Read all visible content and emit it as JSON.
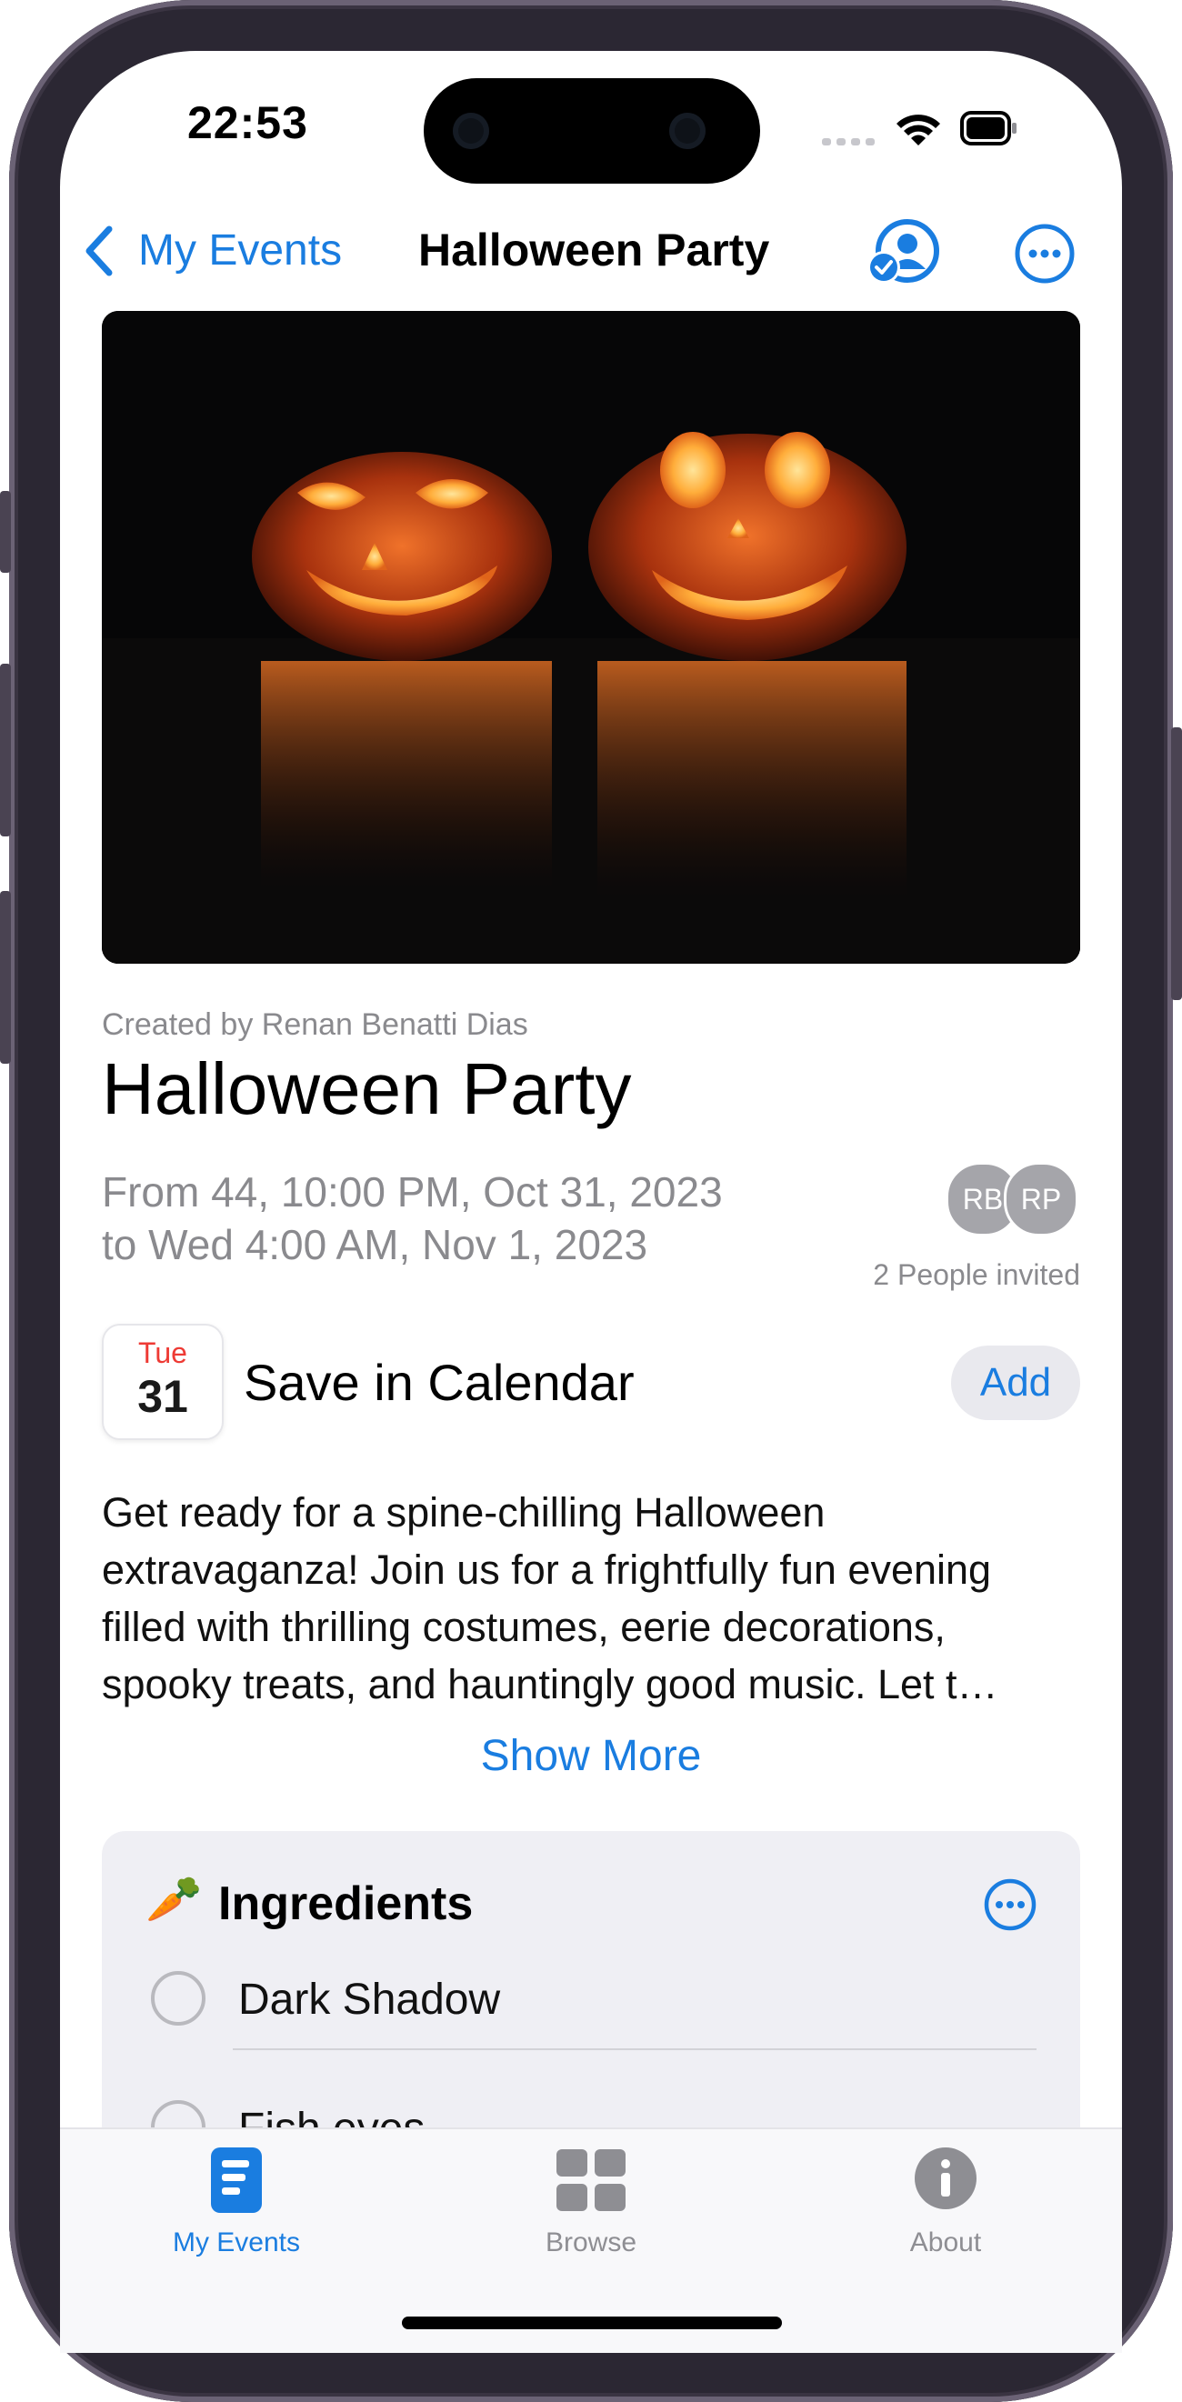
{
  "status_bar": {
    "time": "22:53"
  },
  "nav": {
    "back_label": "My Events",
    "title": "Halloween Party"
  },
  "icons": {
    "back": "chevron-left-icon",
    "guests": "person-check-icon",
    "more": "ellipsis-circle-icon"
  },
  "hero": {
    "alt": "pumpkin-photo"
  },
  "event": {
    "created_by": "Created by Renan Benatti Dias",
    "title": "Halloween Party",
    "date_line_1": "From 44, 10:00 PM, Oct 31, 2023",
    "date_line_2": "to Wed 4:00 AM, Nov 1, 2023",
    "avatars": [
      "RB",
      "RP"
    ],
    "invited": "2 People invited"
  },
  "calendar": {
    "day_name": "Tue",
    "day_num": "31",
    "label": "Save in Calendar",
    "add": "Add"
  },
  "description": {
    "line1": "Get ready for a spine-chilling Halloween",
    "line2": "extravaganza! Join us for a frightfully fun evening",
    "line3": "filled with thrilling costumes, eerie decorations,",
    "line4": "spooky treats, and hauntingly good music. Let t…",
    "show_more": "Show More"
  },
  "ingredients": {
    "emoji": "🥕",
    "title": "Ingredients",
    "items": [
      "Dark Shadow",
      "Fish eyes"
    ]
  },
  "tabs": [
    {
      "label": "My Events",
      "icon": "list-doc-icon",
      "active": true
    },
    {
      "label": "Browse",
      "icon": "grid-icon",
      "active": false
    },
    {
      "label": "About",
      "icon": "info-icon",
      "active": false
    }
  ],
  "colors": {
    "accent": "#1a7de0",
    "secondary_text": "#8a8a8e",
    "card_bg": "#efeff4",
    "calendar_red": "#ee3a34"
  }
}
